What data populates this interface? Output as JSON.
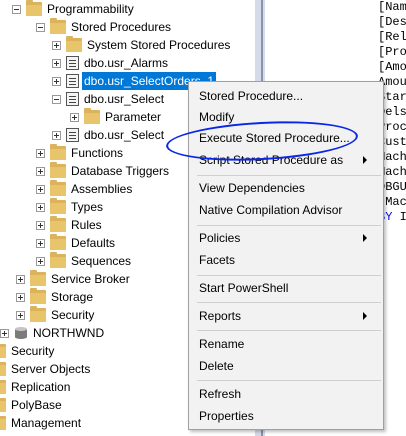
{
  "tree": {
    "programmability": "Programmability",
    "stored_procedures": "Stored Procedures",
    "system_stored_procedures": "System Stored Procedures",
    "usr_alarms": "dbo.usr_Alarms",
    "usr_select_orders_1": "dbo.usr_SelectOrders_1",
    "usr_select_2": "dbo.usr_Select",
    "parameters": "Parameter",
    "usr_select_3": "dbo.usr_Select",
    "functions": "Functions",
    "database_triggers": "Database Triggers",
    "assemblies": "Assemblies",
    "types": "Types",
    "rules": "Rules",
    "defaults": "Defaults",
    "sequences": "Sequences",
    "service_broker": "Service Broker",
    "storage": "Storage",
    "security_db": "Security",
    "northwnd": "NORTHWND",
    "security": "Security",
    "server_objects": "Server Objects",
    "replication": "Replication",
    "polybase": "PolyBase",
    "management": "Management"
  },
  "editor": {
    "lines": [
      "[Name",
      "[Desc",
      "[Relo",
      "[Proc",
      "[Amou",
      "Amou",
      "Star",
      "Dels",
      "Proc",
      "Cust",
      "Mach",
      "Mach",
      "DBGU",
      "[Mac"
    ],
    "last_line_kw": "BY",
    "last_line_rest": " I"
  },
  "context_menu": {
    "stored_procedure": "Stored Procedure...",
    "modify": "Modify",
    "execute": "Execute Stored Procedure...",
    "script_as": "Script Stored Procedure as",
    "view_dependencies": "View Dependencies",
    "native_compilation": "Native Compilation Advisor",
    "policies": "Policies",
    "facets": "Facets",
    "start_powershell": "Start PowerShell",
    "reports": "Reports",
    "rename": "Rename",
    "delete": "Delete",
    "refresh": "Refresh",
    "properties": "Properties"
  },
  "colors": {
    "selection": "#0078d7",
    "annotation_circle": "#0a26e6",
    "menu_background": "#f2f2f2",
    "keyword": "#0000ff"
  }
}
